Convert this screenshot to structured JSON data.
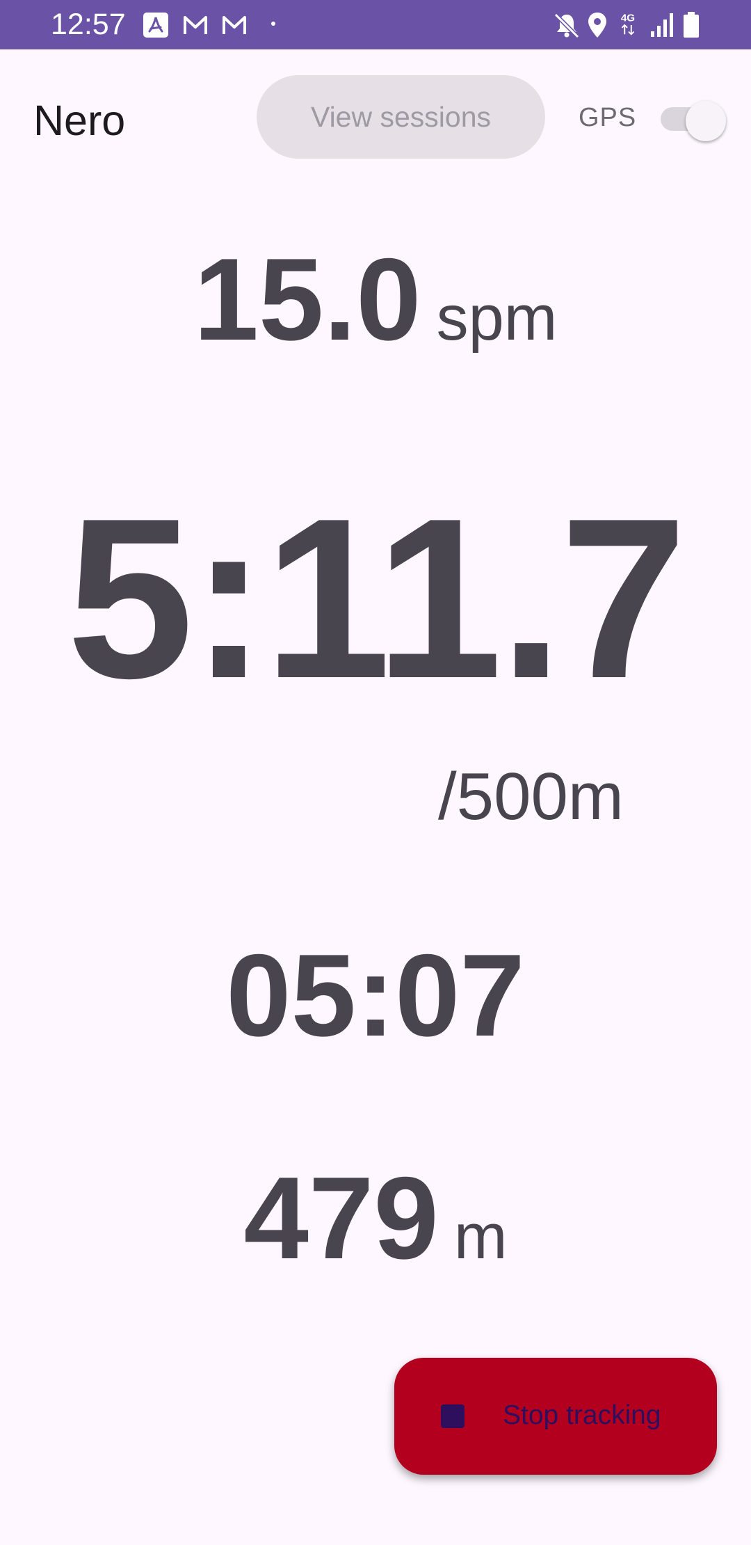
{
  "status_bar": {
    "time": "12:57",
    "icons": [
      "pdf-icon",
      "gmail-icon",
      "gmail-icon",
      "notification-dot",
      "mute-icon",
      "location-icon",
      "4g-icon",
      "signal-icon",
      "battery-icon"
    ],
    "network_label": "4G",
    "background_color": "#6A52A6"
  },
  "header": {
    "title": "Nero",
    "view_sessions_label": "View sessions",
    "gps_label": "GPS",
    "gps_enabled": true
  },
  "metrics": {
    "stroke_rate": {
      "value": "15.0",
      "unit": "spm"
    },
    "split": {
      "value": "5:11.7",
      "unit": "/500m"
    },
    "elapsed": {
      "value": "05:07"
    },
    "distance": {
      "value": "479",
      "unit": "m"
    }
  },
  "fab": {
    "label": "Stop tracking",
    "icon": "stop-icon",
    "background_color": "#B3001F"
  }
}
